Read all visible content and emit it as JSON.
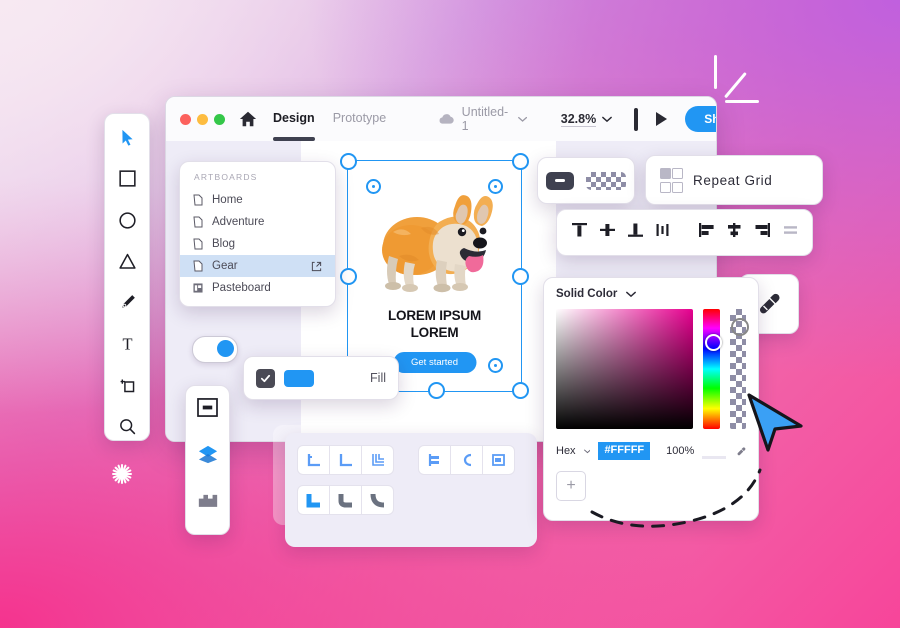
{
  "background": {
    "gradient_from": "#f0dff0",
    "gradient_mid": "#d79fdd",
    "gradient_to": "#f7459a",
    "accent_blue": "#2196f3",
    "dark": "#3f4150"
  },
  "decorations": {
    "sparkle_name": "sparkle-burst",
    "corner_lines_name": "corner-accent-lines",
    "cursor_name": "large-blue-cursor",
    "trail_name": "dashed-curve-trail"
  },
  "toolbar": {
    "tools": [
      {
        "name": "select-tool",
        "icon": "cursor-icon",
        "active": true
      },
      {
        "name": "rectangle-tool",
        "icon": "rectangle-icon",
        "active": false
      },
      {
        "name": "ellipse-tool",
        "icon": "ellipse-icon",
        "active": false
      },
      {
        "name": "polygon-tool",
        "icon": "triangle-icon",
        "active": false
      },
      {
        "name": "pen-tool",
        "icon": "pen-icon",
        "active": false
      },
      {
        "name": "text-tool",
        "icon": "text-t-icon",
        "active": false
      },
      {
        "name": "artboard-tool",
        "icon": "artboard-icon",
        "active": false
      },
      {
        "name": "zoom-tool",
        "icon": "magnifier-icon",
        "active": false
      }
    ]
  },
  "window": {
    "titlebar": {
      "traffic_lights": [
        "close",
        "minimize",
        "maximize"
      ],
      "home_icon": "home-icon",
      "tabs": [
        {
          "label": "Design",
          "active": true
        },
        {
          "label": "Prototype",
          "active": false
        }
      ],
      "cloud_icon": "cloud-icon",
      "document_name": "Untitled-1",
      "document_chevron": "chevron-down-icon",
      "zoom_value": "32.8%",
      "zoom_chevron": "chevron-down-icon",
      "device_preview_icon": "phone-icon",
      "play_icon": "play-icon",
      "share_label": "Share"
    }
  },
  "artboards_panel": {
    "title": "ARTBOARDS",
    "items": [
      {
        "label": "Home",
        "icon": "document-icon",
        "selected": false,
        "external": false
      },
      {
        "label": "Adventure",
        "icon": "document-icon",
        "selected": false,
        "external": false
      },
      {
        "label": "Blog",
        "icon": "document-icon",
        "selected": false,
        "external": false
      },
      {
        "label": "Gear",
        "icon": "document-icon",
        "selected": true,
        "external": true
      },
      {
        "label": "Pasteboard",
        "icon": "pasteboard-icon",
        "selected": false,
        "external": false
      }
    ]
  },
  "canvas": {
    "artwork_name": "corgi-dog-illustration",
    "heading_line1": "LOREM IPSUM",
    "heading_line2": "LOREM",
    "cta_label": "Get started"
  },
  "fill_panel": {
    "checkbox_checked": true,
    "swatch_color": "#2196f3",
    "label": "Fill"
  },
  "toggle": {
    "name": "feature-toggle",
    "state": "on"
  },
  "panel_strip": {
    "items": [
      {
        "name": "panel-assets",
        "icon": "artboard-panel-icon"
      },
      {
        "name": "panel-layers",
        "icon": "layers-icon"
      },
      {
        "name": "panel-plugins",
        "icon": "plugins-icon"
      }
    ]
  },
  "corner_panel": {
    "row1_group1": [
      "corner-style-1",
      "corner-style-2",
      "corner-style-3"
    ],
    "row1_group2": [
      "text-align-1",
      "text-align-2",
      "text-align-3"
    ],
    "row2_group1": [
      "radius-none",
      "radius-small",
      "radius-large"
    ]
  },
  "opacity_panel": {
    "minus_name": "opacity-minus-pill",
    "checker_name": "transparency-checker-pill"
  },
  "repeat_grid": {
    "icon": "grid-2x2-icon",
    "label": "Repeat Grid"
  },
  "align_panel": {
    "group_vertical": [
      "align-top",
      "align-middle-vertical",
      "align-bottom",
      "distribute-vertical"
    ],
    "group_horizontal": [
      "align-left",
      "align-center-horizontal",
      "align-right",
      "distribute-horizontal"
    ]
  },
  "eyedropper_button": {
    "name": "eyedropper-button",
    "icon": "eyedropper-icon"
  },
  "color_picker": {
    "mode_label": "Solid Color",
    "mode_chevron": "chevron-down-icon",
    "format_label": "Hex",
    "format_chevron": "chevron-down-icon",
    "hex_value": "#FFFFF",
    "opacity_value": "100%",
    "eyedropper_icon": "eyedropper-icon",
    "add_swatch_label": "+"
  }
}
